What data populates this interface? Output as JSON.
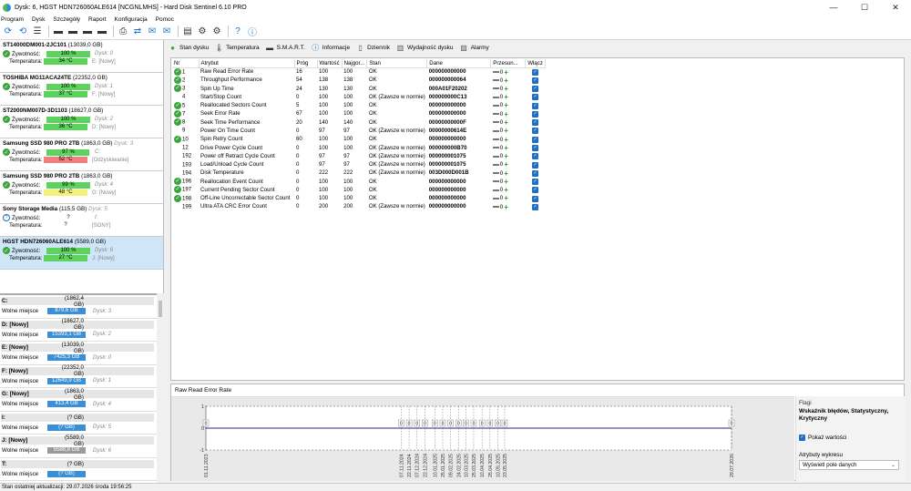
{
  "window": {
    "title": "Dysk: 6, HGST HDN726060ALE614 [NCGNLMHS]  -  Hard Disk Sentinel 6.10 PRO",
    "min": "—",
    "max": "☐",
    "close": "✕"
  },
  "menu": [
    "Program",
    "Dysk",
    "Szczegóły",
    "Raport",
    "Konfiguracja",
    "Pomoc"
  ],
  "toolbar_icons": [
    "refresh-icon",
    "refresh-all-icon",
    "list-icon",
    "disk-icon-1",
    "disk-icon-2",
    "disk-icon-3",
    "disk-icon-4",
    "printer-icon",
    "network-icon",
    "email-icon",
    "email-send-icon",
    "report-icon",
    "settings-icon",
    "tools-icon",
    "help-icon",
    "info-icon"
  ],
  "disks": [
    {
      "name": "ST14000DM001-2JC101",
      "cap": "(13039,0 GB)",
      "dn": "",
      "health_lbl": "Żywotność:",
      "health": "100 %",
      "health_frac": 1.0,
      "health_color": "#5cd35c",
      "temp_lbl": "Temperatura:",
      "temp": "34 °C",
      "temp_color": "#5cd35c",
      "hv": "Dysk: 0",
      "tv": "E: [Nowy]",
      "icon": "ok"
    },
    {
      "name": "TOSHIBA MG11ACA24TE",
      "cap": "(22352,0 GB)",
      "dn": "",
      "health_lbl": "Żywotność:",
      "health": "100 %",
      "health_frac": 1.0,
      "health_color": "#5cd35c",
      "temp_lbl": "Temperatura:",
      "temp": "37 °C",
      "temp_color": "#5cd35c",
      "hv": "Dysk: 1",
      "tv": "F: [Nowy]",
      "icon": "ok"
    },
    {
      "name": "ST2000NM007D-3D1103",
      "cap": "(18627,0 GB)",
      "dn": "",
      "health_lbl": "Żywotność:",
      "health": "100 %",
      "health_frac": 1.0,
      "health_color": "#5cd35c",
      "temp_lbl": "Temperatura:",
      "temp": "36 °C",
      "temp_color": "#5cd35c",
      "hv": "Dysk: 2",
      "tv": "D: [Nowy]",
      "icon": "ok"
    },
    {
      "name": "Samsung SSD 980 PRO 2TB",
      "cap": "(1863,0 GB)",
      "dn": "Dysk: 3",
      "health_lbl": "Żywotność:",
      "health": "97 %",
      "health_frac": 0.97,
      "health_color": "#5cd35c",
      "temp_lbl": "Temperatura:",
      "temp": "52 °C",
      "temp_color": "#f08080",
      "hv": "C:",
      "tv": "[Odzyskiwanie]",
      "icon": "ok"
    },
    {
      "name": "Samsung SSD 980 PRO 2TB",
      "cap": "(1863,0 GB)",
      "dn": "",
      "health_lbl": "Żywotność:",
      "health": "99 %",
      "health_frac": 0.99,
      "health_color": "#5cd35c",
      "temp_lbl": "Temperatura:",
      "temp": "48 °C",
      "temp_color": "#f5f07a",
      "hv": "Dysk: 4",
      "tv": "G: [Nowy]",
      "icon": "ok"
    },
    {
      "name": "Sony    Storage Media",
      "cap": "(115,5 GB)",
      "dn": "Dysk: 5",
      "health_lbl": "Żywotność:",
      "health": "?",
      "health_frac": 0,
      "health_color": "#ffffff",
      "temp_lbl": "Temperatura:",
      "temp": "?",
      "temp_color": "#ffffff",
      "hv": "I:",
      "tv": "[SONY]",
      "icon": "q"
    },
    {
      "name": "HGST HDN726060ALE614",
      "cap": "(5589,0 GB)",
      "dn": "",
      "health_lbl": "Żywotność:",
      "health": "100 %",
      "health_frac": 1.0,
      "health_color": "#5cd35c",
      "temp_lbl": "Temperatura:",
      "temp": "27 °C",
      "temp_color": "#5cd35c",
      "hv": "Dysk: 6",
      "tv": "J: [Nowy]",
      "icon": "ok",
      "selected": true
    }
  ],
  "volumes": [
    {
      "label": "C:",
      "size": "(1862,4 GB)",
      "free_lbl": "Wolne miejsce",
      "free": "879,6 GB",
      "color": "#3a8fd6",
      "disk": "Dysk: 3"
    },
    {
      "label": "D: [Nowy]",
      "size": "(18627,0 GB)",
      "free_lbl": "Wolne miejsce",
      "free": "15393,1 GB",
      "color": "#3a8fd6",
      "disk": "Dysk: 2"
    },
    {
      "label": "E: [Nowy]",
      "size": "(13039,0 GB)",
      "free_lbl": "Wolne miejsce",
      "free": "7425,3 GB",
      "color": "#3a8fd6",
      "disk": "Dysk: 0"
    },
    {
      "label": "F: [Nowy]",
      "size": "(22352,0 GB)",
      "free_lbl": "Wolne miejsce",
      "free": "12649,9 GB",
      "color": "#3a8fd6",
      "disk": "Dysk: 1"
    },
    {
      "label": "G: [Nowy]",
      "size": "(1863,0 GB)",
      "free_lbl": "Wolne miejsce",
      "free": "413,4 GB",
      "color": "#3a8fd6",
      "disk": "Dysk: 4"
    },
    {
      "label": "I:",
      "size": "(? GB)",
      "free_lbl": "Wolne miejsce",
      "free": "(? GB)",
      "color": "#3a8fd6",
      "disk": "Dysk: 5"
    },
    {
      "label": "J: [Nowy]",
      "size": "(5589,0 GB)",
      "free_lbl": "Wolne miejsce",
      "free": "5588,8 GB",
      "color": "#9a9a9a",
      "disk": "Dysk: 6"
    },
    {
      "label": "T:",
      "size": "(? GB)",
      "free_lbl": "Wolne miejsce",
      "free": "(? GB)",
      "color": "#3a8fd6",
      "disk": ""
    },
    {
      "label": "U:",
      "size": "(? GB)",
      "free_lbl": "",
      "free": "",
      "color": "#3a8fd6",
      "disk": ""
    }
  ],
  "status": "Stan ostatniej aktualizacji: 29.07.2026 środa 19:56:25",
  "tabs": [
    {
      "label": "Stan dysku",
      "icon": "check-icon"
    },
    {
      "label": "Temperatura",
      "icon": "thermometer-icon"
    },
    {
      "label": "S.M.A.R.T.",
      "icon": "smart-icon"
    },
    {
      "label": "Informacje",
      "icon": "info-icon"
    },
    {
      "label": "Dziennik",
      "icon": "log-icon"
    },
    {
      "label": "Wydajność dysku",
      "icon": "performance-icon"
    },
    {
      "label": "Alarmy",
      "icon": "alarm-icon"
    }
  ],
  "smart": {
    "headers": [
      "Nr",
      "Atrybut",
      "Próg",
      "Wartość",
      "Najgor...",
      "Stan",
      "Dane",
      "Przesun...",
      "Włącz"
    ],
    "rows": [
      {
        "nr": "1",
        "attr": "Raw Read Error Rate",
        "prog": "16",
        "wart": "100",
        "najg": "100",
        "stan": "OK",
        "dane": "000000000000",
        "prz": "0",
        "check": true
      },
      {
        "nr": "2",
        "attr": "Throughput Performance",
        "prog": "54",
        "wart": "138",
        "najg": "138",
        "stan": "OK",
        "dane": "000000000064",
        "prz": "0",
        "check": true
      },
      {
        "nr": "3",
        "attr": "Spin Up Time",
        "prog": "24",
        "wart": "130",
        "najg": "130",
        "stan": "OK",
        "dane": "000A01F20202",
        "prz": "0",
        "check": true
      },
      {
        "nr": "4",
        "attr": "Start/Stop Count",
        "prog": "0",
        "wart": "100",
        "najg": "100",
        "stan": "OK (Zawsze w normie)",
        "dane": "000000000C13",
        "prz": "0",
        "check": false
      },
      {
        "nr": "5",
        "attr": "Reallocated Sectors Count",
        "prog": "5",
        "wart": "100",
        "najg": "100",
        "stan": "OK",
        "dane": "000000000000",
        "prz": "0",
        "check": true
      },
      {
        "nr": "7",
        "attr": "Seek Error Rate",
        "prog": "67",
        "wart": "100",
        "najg": "100",
        "stan": "OK",
        "dane": "000000000000",
        "prz": "0",
        "check": true
      },
      {
        "nr": "8",
        "attr": "Seek Time Performance",
        "prog": "20",
        "wart": "140",
        "najg": "140",
        "stan": "OK",
        "dane": "00000000000F",
        "prz": "0",
        "check": true
      },
      {
        "nr": "9",
        "attr": "Power On Time Count",
        "prog": "0",
        "wart": "97",
        "najg": "97",
        "stan": "OK (Zawsze w normie)",
        "dane": "00000000614E",
        "prz": "0",
        "check": false
      },
      {
        "nr": "10",
        "attr": "Spin Retry Count",
        "prog": "60",
        "wart": "100",
        "najg": "100",
        "stan": "OK",
        "dane": "000000000000",
        "prz": "0",
        "check": true
      },
      {
        "nr": "12",
        "attr": "Drive Power Cycle Count",
        "prog": "0",
        "wart": "100",
        "najg": "100",
        "stan": "OK (Zawsze w normie)",
        "dane": "000000000B70",
        "prz": "0",
        "check": false
      },
      {
        "nr": "192",
        "attr": "Power off Retract Cycle Count",
        "prog": "0",
        "wart": "97",
        "najg": "97",
        "stan": "OK (Zawsze w normie)",
        "dane": "000000001075",
        "prz": "0",
        "check": false
      },
      {
        "nr": "193",
        "attr": "Load/Unload Cycle Count",
        "prog": "0",
        "wart": "97",
        "najg": "97",
        "stan": "OK (Zawsze w normie)",
        "dane": "000000001075",
        "prz": "0",
        "check": false
      },
      {
        "nr": "194",
        "attr": "Disk Temperature",
        "prog": "0",
        "wart": "222",
        "najg": "222",
        "stan": "OK (Zawsze w normie)",
        "dane": "003D000D001B",
        "prz": "0",
        "check": false
      },
      {
        "nr": "196",
        "attr": "Reallocation Event Count",
        "prog": "0",
        "wart": "100",
        "najg": "100",
        "stan": "OK",
        "dane": "000000000000",
        "prz": "0",
        "check": true
      },
      {
        "nr": "197",
        "attr": "Current Pending Sector Count",
        "prog": "0",
        "wart": "100",
        "najg": "100",
        "stan": "OK",
        "dane": "000000000000",
        "prz": "0",
        "check": true
      },
      {
        "nr": "198",
        "attr": "Off-Line Uncorrectable Sector Count",
        "prog": "0",
        "wart": "100",
        "najg": "100",
        "stan": "OK",
        "dane": "000000000000",
        "prz": "0",
        "check": true
      },
      {
        "nr": "199",
        "attr": "Ultra ATA CRC Error Count",
        "prog": "0",
        "wart": "200",
        "najg": "200",
        "stan": "OK (Zawsze w normie)",
        "dane": "000000000000",
        "prz": "0",
        "check": false
      }
    ]
  },
  "chart_panel": {
    "title": "Raw Read Error Rate",
    "flags_label": "Flagi",
    "flags_value": "Wskaźnik błędów, Statystyczny, Krytyczny",
    "show_values": "Pokaż wartości",
    "chart_attrs_label": "Atrybuty wykresu",
    "chart_attrs_value": "Wyświetl pole danych"
  },
  "chart_data": {
    "type": "line",
    "title": "Raw Read Error Rate",
    "xlabel": "",
    "ylabel": "",
    "yticks": [
      "1",
      "0",
      "-1"
    ],
    "ylim": [
      -1,
      1
    ],
    "x": [
      "01.11.2023",
      "07.11.2024",
      "22.11.2024",
      "07.12.2024",
      "22.12.2024",
      "10.01.2025",
      "25.01.2025",
      "09.02.2025",
      "24.02.2025",
      "10.03.2025",
      "25.03.2025",
      "10.04.2025",
      "25.04.2025",
      "10.05.2025",
      "23.05.2025",
      "29.07.2026"
    ],
    "x_days": [
      0,
      372,
      387,
      402,
      417,
      436,
      451,
      466,
      481,
      495,
      510,
      526,
      541,
      556,
      569,
      1001
    ],
    "series": [
      {
        "values": [
          0,
          0,
          0,
          0,
          0,
          0,
          0,
          0,
          0,
          0,
          0,
          0,
          0,
          0,
          0,
          0
        ]
      }
    ],
    "labeled_points": [
      0,
      1,
      2,
      3,
      4,
      5,
      6,
      7,
      8,
      9,
      10,
      11,
      12,
      13,
      14,
      15
    ],
    "point_label": "0",
    "line_color": "#2a2a8a"
  }
}
